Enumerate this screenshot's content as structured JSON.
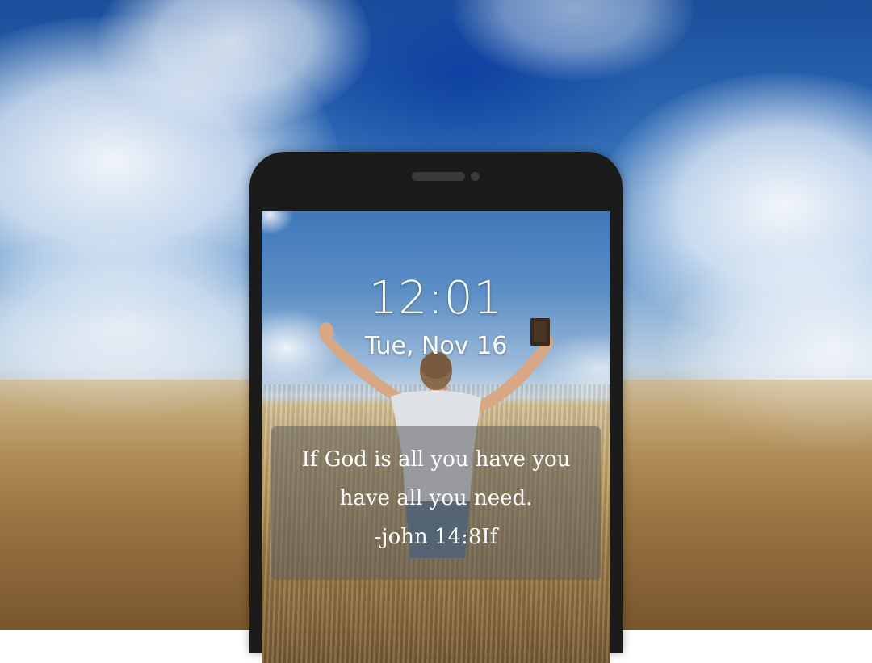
{
  "lockscreen": {
    "time": "12:01",
    "date": "Tue, Nov 16",
    "quote": {
      "line1": "If God is all you have you",
      "line2": "have all you need.",
      "reference": "-john 14:8If"
    }
  },
  "colors": {
    "phone_bezel": "#1b1b1b",
    "text": "#ffffff",
    "quote_panel": "#5f5f5f"
  },
  "icons": {
    "speaker": "speaker-grille-icon",
    "camera": "front-camera-icon"
  }
}
